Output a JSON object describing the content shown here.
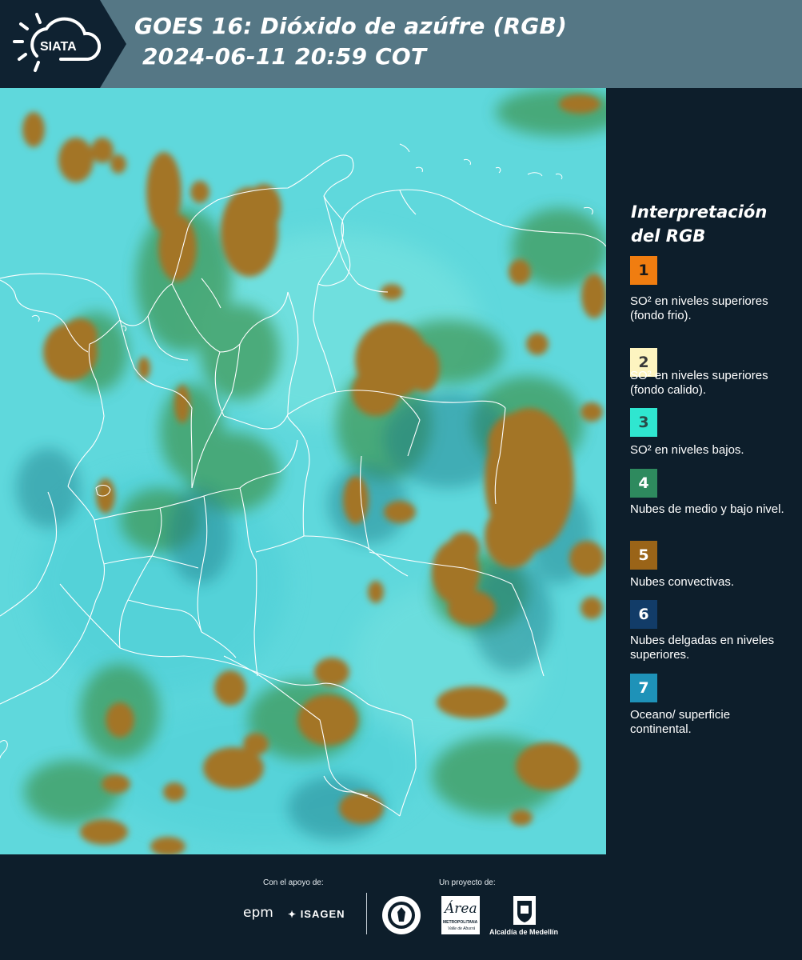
{
  "header": {
    "logo_text": "SIATA",
    "title_line1": "GOES 16: Dióxido de azúfre (RGB)",
    "title_line2": "2024-06-11 20:59 COT"
  },
  "legend": {
    "title": "Interpretación del RGB",
    "items": [
      {
        "num": "1",
        "color": "#f07d10",
        "num_color": "#1a1a1a",
        "label": "SO² en niveles superiores (fondo frio)."
      },
      {
        "num": "2",
        "color": "#fdf4c0",
        "num_color": "#3a3a3a",
        "label": "SO² en niveles superiores (fondo calido)."
      },
      {
        "num": "3",
        "color": "#2fe6d0",
        "num_color": "#2a4a48",
        "label": "SO² en niveles bajos."
      },
      {
        "num": "4",
        "color": "#2e8a5e",
        "num_color": "#ffffff",
        "label": "Nubes de medio y bajo nivel."
      },
      {
        "num": "5",
        "color": "#9a6418",
        "num_color": "#ffffff",
        "label": "Nubes convectivas."
      },
      {
        "num": "6",
        "color": "#123c68",
        "num_color": "#ffffff",
        "label": "Nubes delgadas en niveles superiores."
      },
      {
        "num": "7",
        "color": "#1e92b8",
        "num_color": "#ffffff",
        "label": "Oceano/ superficie continental."
      }
    ]
  },
  "footer": {
    "support_label": "Con el apoyo de:",
    "project_label": "Un proyecto de:",
    "partner_epm": "epm",
    "partner_isagen": "ISAGEN",
    "area_logo_text": "Área",
    "area_subtext1": "METROPOLITANA",
    "area_subtext2": "Valle de Aburrá",
    "alcaldia_text": "Alcaldía de Medellín"
  },
  "colors": {
    "header_bg": "#557785",
    "panel_bg": "#0d1e2b",
    "map_background": "#5fd8dc",
    "cloud_convective": "#a37426",
    "cloud_low_mid": "#3f9a5a",
    "border_lines": "#ffffff"
  }
}
